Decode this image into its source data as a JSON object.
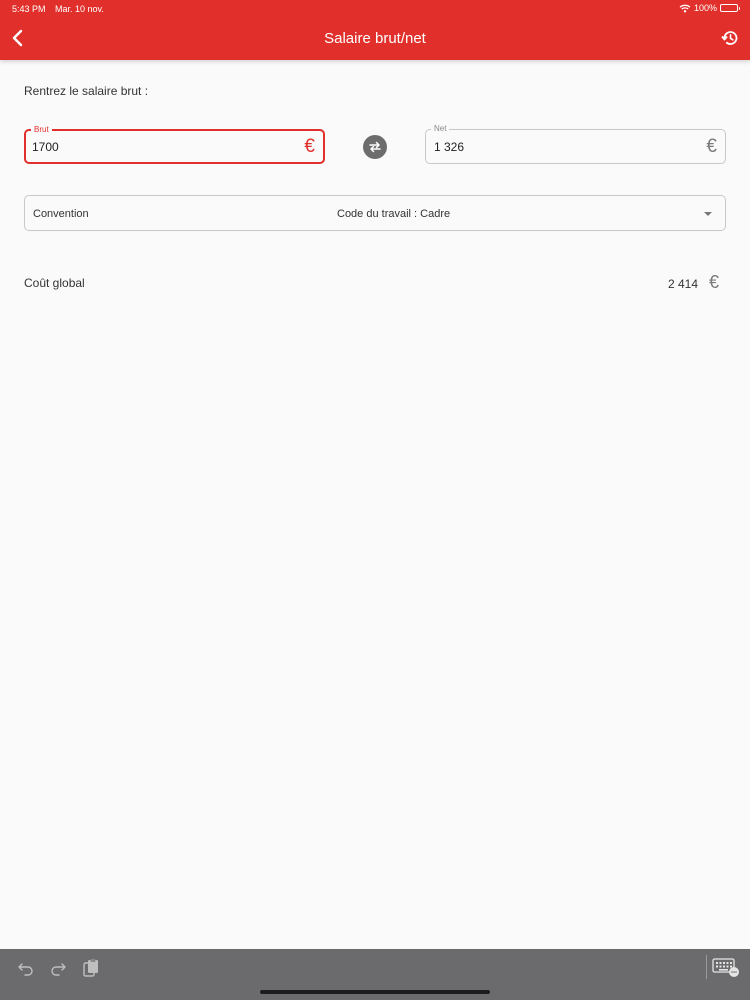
{
  "status_bar": {
    "time": "5:43 PM",
    "date": "Mar. 10 nov.",
    "battery": "100%"
  },
  "header": {
    "title": "Salaire brut/net",
    "back_icon": "chevron-left-icon",
    "history_icon": "history-icon"
  },
  "form": {
    "prompt": "Rentrez le salaire brut :",
    "brut": {
      "label": "Brut",
      "value": "1700",
      "currency": "€"
    },
    "net": {
      "label": "Net",
      "value": "1 326",
      "currency": "€"
    },
    "swap_icon": "swap-icon"
  },
  "convention": {
    "label": "Convention",
    "value": "Code du travail : Cadre"
  },
  "cost": {
    "label": "Coût global",
    "value": "2 414",
    "currency": "€"
  },
  "colors": {
    "accent": "#e1302b",
    "toolbar": "#6b6b6d",
    "background": "#fafafa"
  },
  "toolbar": {
    "icons": [
      "undo-icon",
      "redo-icon",
      "paste-icon",
      "keyboard-icon"
    ]
  }
}
